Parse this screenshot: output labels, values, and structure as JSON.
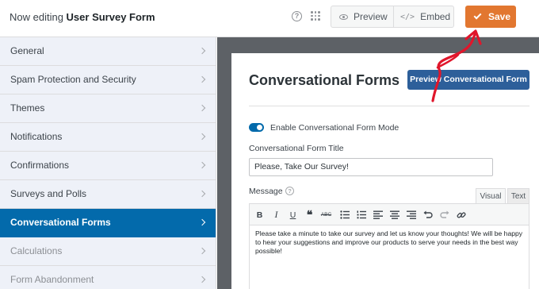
{
  "header": {
    "editing_prefix": "Now editing ",
    "form_name": "User Survey Form",
    "help_icon": "?",
    "preview_label": "Preview",
    "embed_label": "Embed",
    "save_label": "Save"
  },
  "sidebar": {
    "items": [
      {
        "label": "General",
        "state": "normal"
      },
      {
        "label": "Spam Protection and Security",
        "state": "normal"
      },
      {
        "label": "Themes",
        "state": "normal"
      },
      {
        "label": "Notifications",
        "state": "normal"
      },
      {
        "label": "Confirmations",
        "state": "normal"
      },
      {
        "label": "Surveys and Polls",
        "state": "normal"
      },
      {
        "label": "Conversational Forms",
        "state": "active"
      },
      {
        "label": "Calculations",
        "state": "muted"
      },
      {
        "label": "Form Abandonment",
        "state": "muted"
      }
    ]
  },
  "main": {
    "title": "Conversational Forms",
    "preview_button": "Preview Conversational Form",
    "toggle_label": "Enable Conversational Form Mode",
    "toggle_on": true,
    "title_field_label": "Conversational Form Title",
    "title_field_value": "Please, Take Our Survey!",
    "message_label": "Message",
    "message_help": "?",
    "tab_visual": "Visual",
    "tab_text": "Text",
    "message_body": "Please take a minute to take our survey and let us know your thoughts! We will be happy to hear your suggestions and improve our products to serve your needs in the best way possible!"
  },
  "toolbar": {
    "bold": "B",
    "italic": "I",
    "underline": "U",
    "quote": "❝",
    "strike": "ABC"
  },
  "colors": {
    "accent": "#036aab",
    "save": "#e27730",
    "annotation_arrow": "#e0162b"
  }
}
